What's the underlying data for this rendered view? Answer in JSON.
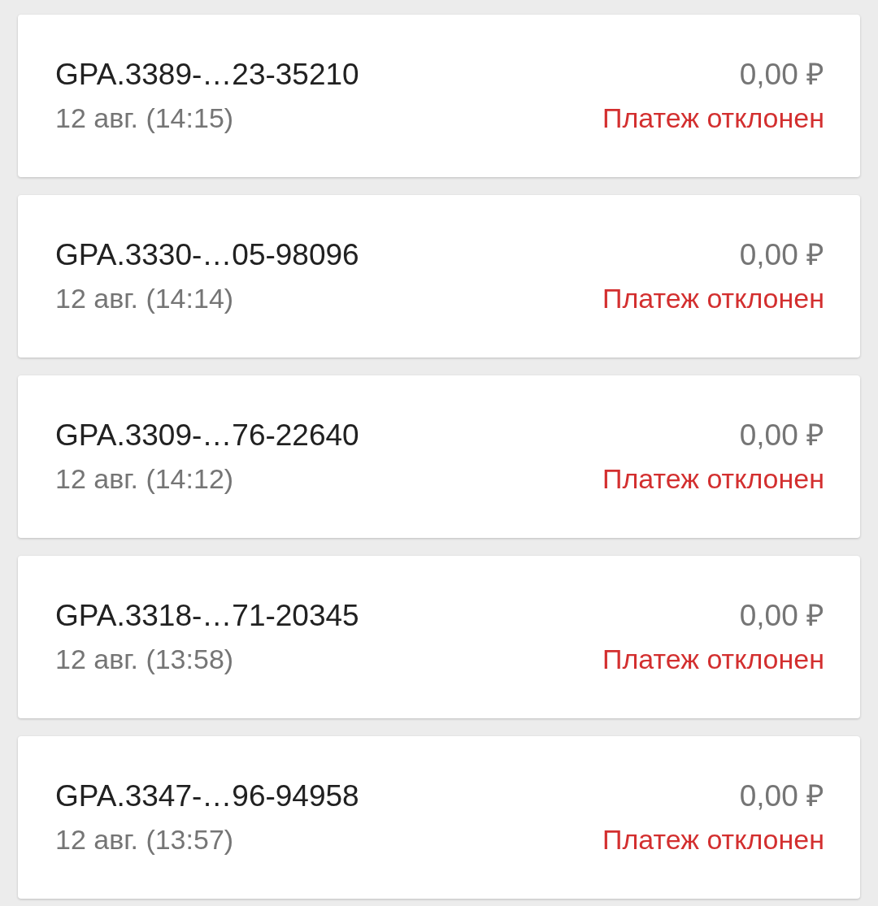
{
  "payments": [
    {
      "id": "GPA.3389-…23-35210",
      "date": "12 авг. (14:15)",
      "amount": "0,00 ₽",
      "status": "Платеж отклонен",
      "kind": "declined"
    },
    {
      "id": "GPA.3330-…05-98096",
      "date": "12 авг. (14:14)",
      "amount": "0,00 ₽",
      "status": "Платеж отклонен",
      "kind": "declined"
    },
    {
      "id": "GPA.3309-…76-22640",
      "date": "12 авг. (14:12)",
      "amount": "0,00 ₽",
      "status": "Платеж отклонен",
      "kind": "declined"
    },
    {
      "id": "GPA.3318-…71-20345",
      "date": "12 авг. (13:58)",
      "amount": "0,00 ₽",
      "status": "Платеж отклонен",
      "kind": "declined"
    },
    {
      "id": "GPA.3347-…96-94958",
      "date": "12 авг. (13:57)",
      "amount": "0,00 ₽",
      "status": "Платеж отклонен",
      "kind": "declined"
    }
  ]
}
